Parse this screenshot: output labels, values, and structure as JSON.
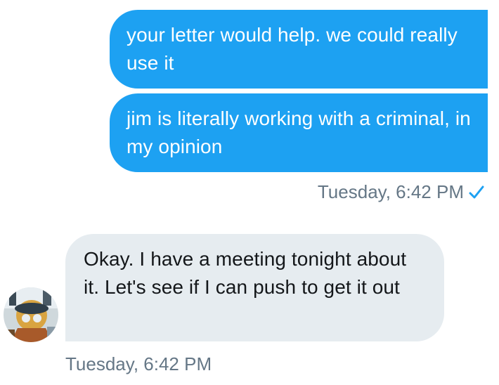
{
  "conversation": {
    "sent_messages": [
      {
        "text": "your letter would help. we could really use it"
      },
      {
        "text": "jim is literally working with a criminal, in my opinion"
      }
    ],
    "sent_timestamp": "Tuesday, 6:42 PM",
    "sent_status_icon": "check-icon",
    "received_message": {
      "text": "Okay. I have a meeting tonight about it. Let's see if I can push to get it out"
    },
    "received_timestamp": "Tuesday, 6:42 PM",
    "received_avatar": "avatar"
  },
  "colors": {
    "sent_bubble": "#1da1f2",
    "received_bubble": "#e6ecf0",
    "timestamp": "#657786",
    "check": "#1da1f2"
  }
}
